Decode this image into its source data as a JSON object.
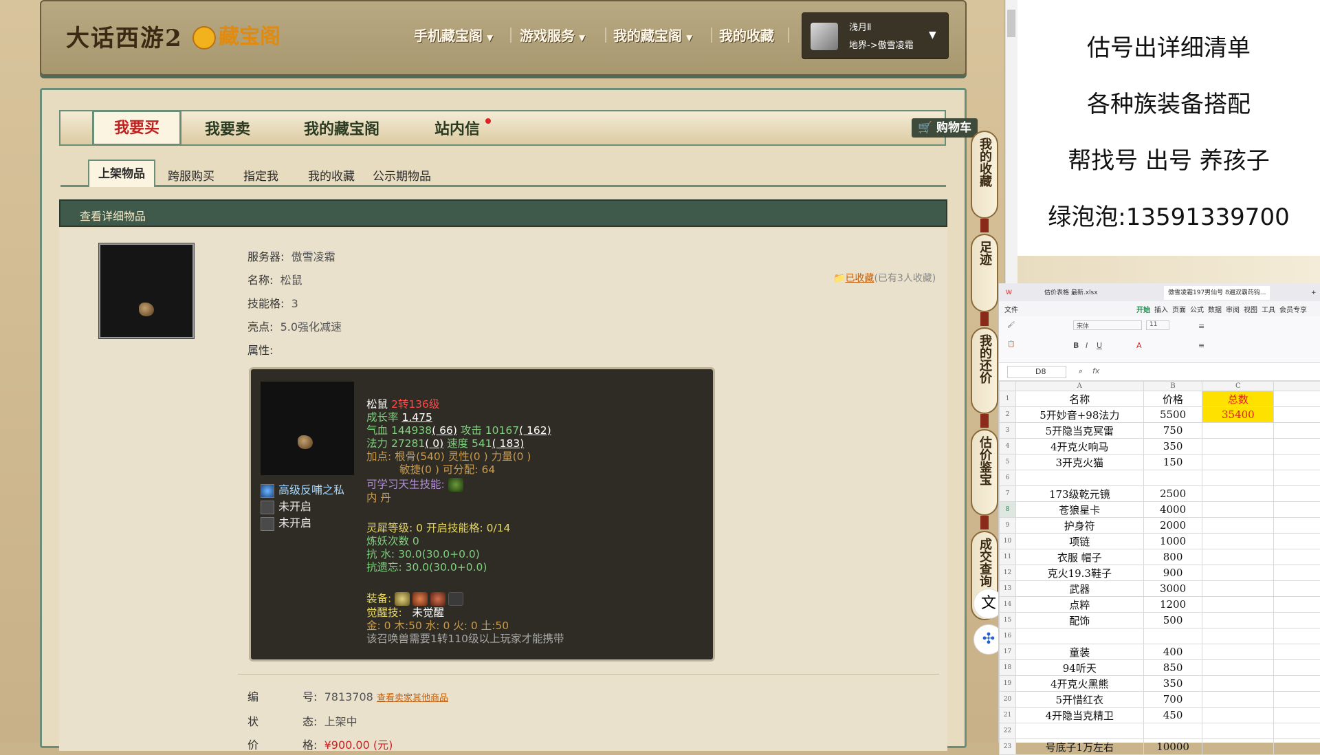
{
  "header": {
    "logo_game": "大话西游2",
    "logo_site": "藏宝阁",
    "nav": [
      "手机藏宝阁",
      "游戏服务",
      "我的藏宝阁",
      "我的收藏"
    ],
    "user_name": "浅月Ⅱ",
    "user_server": "地界->傲雪凌霜"
  },
  "main_tabs": [
    "我要买",
    "我要卖",
    "我的藏宝阁",
    "站内信"
  ],
  "cart_label": "购物车",
  "sub_tabs": [
    "上架物品",
    "跨服购买",
    "指定我",
    "我的收藏",
    "公示期物品"
  ],
  "detail_title": "查看详细物品",
  "fields": {
    "server_label": "服务器:",
    "server": "傲雪凌霜",
    "name_label": "名称:",
    "name": "松鼠",
    "skills_label": "技能格:",
    "skills": "3",
    "highlight_label": "亮点:",
    "highlight": "5.0强化减速",
    "attr_label": "属性:"
  },
  "favorite": {
    "link": "已收藏",
    "count": "(已有3人收藏)"
  },
  "pet_card": {
    "skills": [
      "高级反哺之私",
      "未开启",
      "未开启"
    ],
    "name": "松鼠",
    "level": "2转136级",
    "growth_label": "成长率",
    "growth": "1.475",
    "hp_label": "气血",
    "hp": "144938",
    "hp_add": "( 66)",
    "atk_label": "攻击",
    "atk": "10167",
    "atk_add": "( 162)",
    "mp_label": "法力",
    "mp": "27281",
    "mp_add": "( 0)",
    "spd_label": "速度",
    "spd": "541",
    "spd_add": "( 183)",
    "points_line1": "加点:  根骨(540) 灵性(0 ) 力量(0 )",
    "points_line2": "敏捷(0 ) 可分配:  64",
    "innate_label": "可学习天生技能:",
    "neidan_label": "内   丹",
    "lingxi": "灵犀等级: 0  开启技能格: 0/14",
    "lianyao": "炼妖次数 0",
    "resist_water": "抗    水: 30.0(30.0+0.0)",
    "resist_forget": "抗遗忘: 30.0(30.0+0.0)",
    "equip_label": "装备:",
    "awaken_label": "觉醒技:",
    "awaken_value": "未觉醒",
    "elements": "金: 0 木:50 水: 0 火: 0 土:50",
    "requirement": "该召唤兽需要1转110级以上玩家才能携带"
  },
  "bottom": {
    "id_label1": "编",
    "id_label2": "号:",
    "id_value": "7813708",
    "id_link": "查看卖家其他商品",
    "status_label1": "状",
    "status_label2": "态:",
    "status_value": "上架中",
    "price_label1": "价",
    "price_label2": "格:",
    "price_value": "¥900.00 (元)"
  },
  "right_strip": [
    "我的收藏",
    "足迹",
    "我的还价",
    "估价鉴宝",
    "成交查询"
  ],
  "overlay_lines": [
    "估号出详细清单",
    "各种族装备搭配",
    "帮找号  出号  养孩子",
    "绿泡泡:13591339700"
  ],
  "spreadsheet": {
    "tab1": "估价表格 最新.xlsx",
    "tab2": "傲雪凌霜197男仙号 8遍双霸药钩...",
    "menu": [
      "文件",
      "开始",
      "插入",
      "页面",
      "公式",
      "数据",
      "审阅",
      "视图",
      "工具",
      "会员专享"
    ],
    "font_name": "宋体",
    "font_size": "11",
    "cell_ref": "D8",
    "col_headers": [
      "A",
      "B",
      "C"
    ],
    "rows": [
      {
        "n": "1",
        "a": "名称",
        "b": "价格",
        "c": "总数"
      },
      {
        "n": "2",
        "a": "5开妙音+98法力",
        "b": "5500",
        "c": "35400"
      },
      {
        "n": "3",
        "a": "5开隐当克冥雷",
        "b": "750",
        "c": ""
      },
      {
        "n": "4",
        "a": "4开克火响马",
        "b": "350",
        "c": ""
      },
      {
        "n": "5",
        "a": "3开克火猫",
        "b": "150",
        "c": ""
      },
      {
        "n": "6",
        "a": "",
        "b": "",
        "c": ""
      },
      {
        "n": "7",
        "a": "173级乾元镜",
        "b": "2500",
        "c": ""
      },
      {
        "n": "8",
        "a": "苍狼星卡",
        "b": "4000",
        "c": ""
      },
      {
        "n": "9",
        "a": "护身符",
        "b": "2000",
        "c": ""
      },
      {
        "n": "10",
        "a": "项链",
        "b": "1000",
        "c": ""
      },
      {
        "n": "11",
        "a": "衣服  帽子",
        "b": "800",
        "c": ""
      },
      {
        "n": "12",
        "a": "克火19.3鞋子",
        "b": "900",
        "c": ""
      },
      {
        "n": "13",
        "a": "武器",
        "b": "3000",
        "c": ""
      },
      {
        "n": "14",
        "a": "点粹",
        "b": "1200",
        "c": ""
      },
      {
        "n": "15",
        "a": "配饰",
        "b": "500",
        "c": ""
      },
      {
        "n": "16",
        "a": "",
        "b": "",
        "c": ""
      },
      {
        "n": "17",
        "a": "童装",
        "b": "400",
        "c": ""
      },
      {
        "n": "18",
        "a": "94听天",
        "b": "850",
        "c": ""
      },
      {
        "n": "19",
        "a": "4开克火黑熊",
        "b": "350",
        "c": ""
      },
      {
        "n": "20",
        "a": "5开惜红衣",
        "b": "700",
        "c": ""
      },
      {
        "n": "21",
        "a": "4开隐当克精卫",
        "b": "450",
        "c": ""
      },
      {
        "n": "22",
        "a": "",
        "b": "",
        "c": ""
      },
      {
        "n": "23",
        "a": "号底子1万左右",
        "b": "10000",
        "c": ""
      }
    ]
  },
  "colors": {
    "accent_green": "#3f5a4a",
    "highlight_yellow": "#ffe100",
    "price_red": "#d02020"
  }
}
